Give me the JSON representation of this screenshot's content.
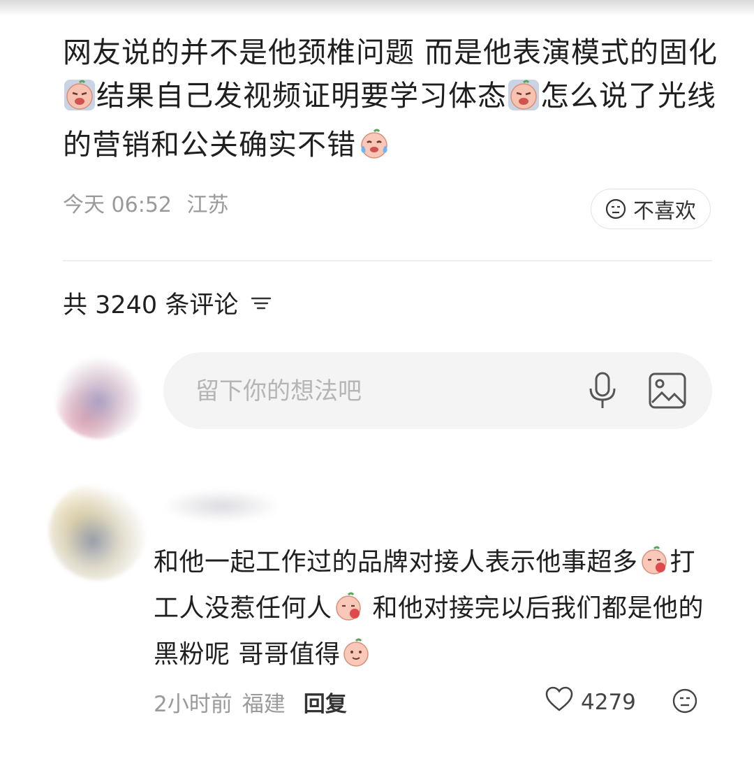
{
  "post": {
    "segments": [
      "网友说的并不是他颈椎问题 而是他表演模式的固化",
      "结果自己发视频证明要学习体态",
      "怎么说了光线的营销和公关确实不错"
    ],
    "emojis": [
      "crying-peach-icon",
      "crying-peach-icon",
      "tears-peach-icon"
    ],
    "time": "今天 06:52",
    "location": "江苏",
    "dislike_label": "不喜欢"
  },
  "comments_header": {
    "count_label": "共 3240 条评论"
  },
  "input": {
    "placeholder": "留下你的想法吧"
  },
  "comment": {
    "segments": [
      "和他一起工作过的品牌对接人表示他事超多",
      "打工人没惹任何人",
      " 和他对接完以后我们都是他的黑粉呢 哥哥值得"
    ],
    "time": "2小时前",
    "location": "福建",
    "reply_label": "回复",
    "likes": "4279"
  }
}
